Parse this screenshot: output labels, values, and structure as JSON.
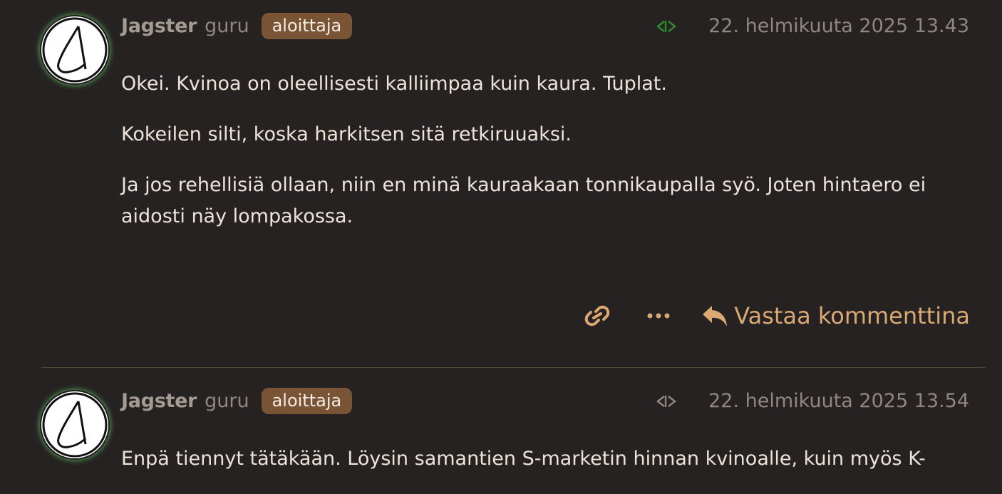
{
  "posts": [
    {
      "author": "Jagster",
      "rank": "guru",
      "badge": "aloittaja",
      "timestamp": "22. helmikuuta 2025 13.43",
      "paragraphs": [
        "Okei. Kvinoa on oleellisesti kalliimpaa kuin kaura. Tuplat.",
        "Kokeilen silti, koska harkitsen sitä retkiruuaksi.",
        "Ja jos rehellisiä ollaan, niin en minä kauraakaan tonnikaupalla syö. Joten hintaero ei aidosti näy lompakossa."
      ],
      "sync_icon_color": "#2e8b2e"
    },
    {
      "author": "Jagster",
      "rank": "guru",
      "badge": "aloittaja",
      "timestamp": "22. helmikuuta 2025 13.54",
      "paragraphs": [
        "Enpä tiennyt tätäkään. Löysin samantien S-marketin hinnan kvinoalle, kuin myös K-"
      ],
      "sync_icon_color": "#8f8780"
    }
  ],
  "actions": {
    "link_icon": "link-icon",
    "more_icon": "more-icon",
    "reply_label": "Vastaa kommenttina"
  },
  "colors": {
    "background": "#262222",
    "accent": "#d9a873",
    "badge": "#7a5535"
  }
}
